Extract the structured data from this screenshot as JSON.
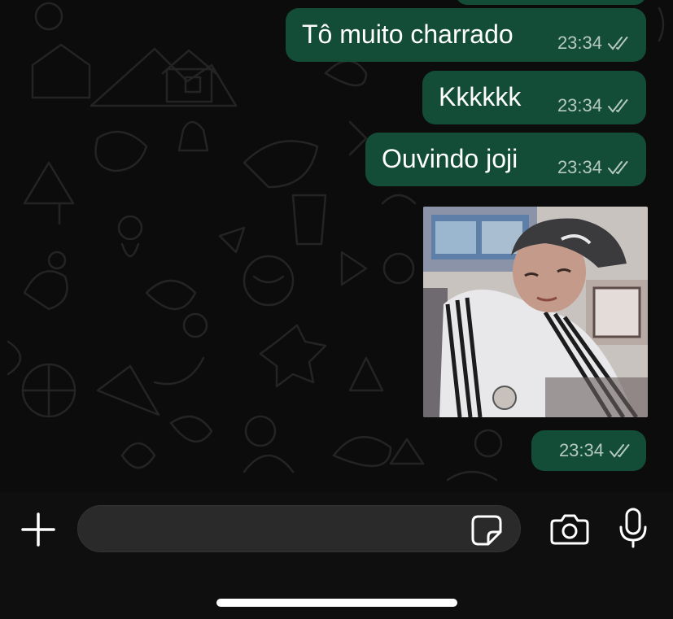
{
  "messages": [
    {
      "text": "Tô muito charrado",
      "time": "23:34"
    },
    {
      "text": "Kkkkkk",
      "time": "23:34"
    },
    {
      "text": "Ouvindo joji",
      "time": "23:34"
    },
    {
      "image": "selfie-photo",
      "time": "23:34"
    }
  ],
  "input": {
    "placeholder": ""
  },
  "icons": [
    "plus-icon",
    "sticker-icon",
    "camera-icon",
    "mic-icon",
    "read-ticks-icon"
  ],
  "colors": {
    "bubble": "#134d37",
    "background": "#0c0c0c",
    "input_field": "#2a2a2a",
    "ticks": "#b5c9bf"
  }
}
